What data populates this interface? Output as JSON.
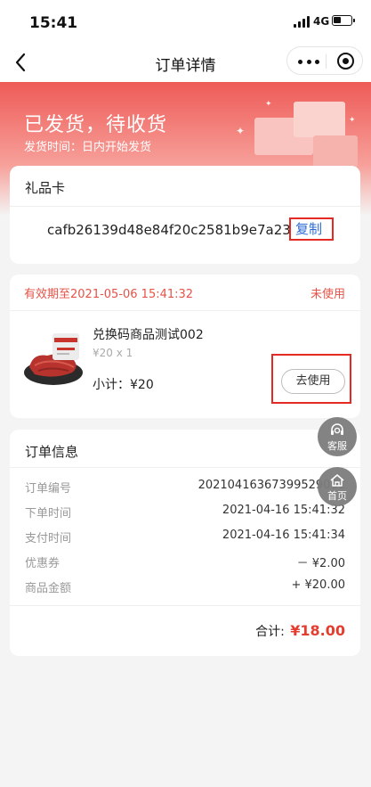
{
  "status_bar": {
    "time": "15:41",
    "network": "4G"
  },
  "nav": {
    "title": "订单详情"
  },
  "hero": {
    "status_title": "已发货，待收货",
    "ship_time": "发货时间：日内开始发货"
  },
  "gift_card": {
    "title": "礼品卡",
    "code": "cafb26139d48e84f20c2581b9e7a2336",
    "copy_label": "复制"
  },
  "voucher": {
    "validity": "有效期至2021-05-06 15:41:32",
    "status": "未使用",
    "product_name": "兑换码商品测试002",
    "spec": "¥20 x 1",
    "subtotal": "小计：¥20",
    "use_label": "去使用"
  },
  "order_info": {
    "title": "订单信息",
    "rows": [
      {
        "label": "订单编号",
        "value": "20210416367399529061"
      },
      {
        "label": "下单时间",
        "value": "2021-04-16 15:41:32"
      },
      {
        "label": "支付时间",
        "value": "2021-04-16 15:41:34"
      },
      {
        "label": "优惠券",
        "value": "－ ¥2.00"
      },
      {
        "label": "商品金额",
        "value": "+ ¥20.00"
      }
    ],
    "total_label": "合计:",
    "total_value": "¥18.00"
  },
  "float_buttons": {
    "service_label": "客服",
    "home_label": "首页"
  },
  "colors": {
    "accent_red": "#e55348",
    "link_blue": "#2d6bd6",
    "highlight_frame": "#e42a22"
  }
}
